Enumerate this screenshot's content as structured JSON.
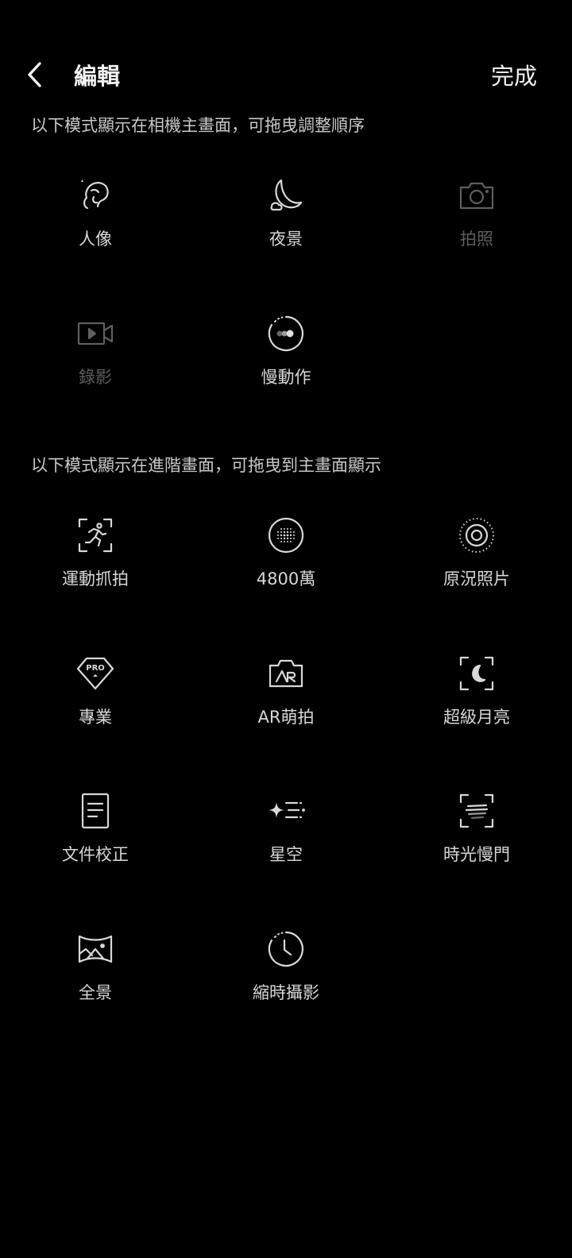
{
  "header": {
    "title": "編輯",
    "done_label": "完成"
  },
  "main_section": {
    "description": "以下模式顯示在相機主畫面，可拖曳調整順序",
    "modes": [
      {
        "label": "人像",
        "icon": "portrait-icon",
        "enabled": true
      },
      {
        "label": "夜景",
        "icon": "moon-icon",
        "enabled": true
      },
      {
        "label": "拍照",
        "icon": "camera-icon",
        "enabled": false
      },
      {
        "label": "錄影",
        "icon": "video-icon",
        "enabled": false
      },
      {
        "label": "慢動作",
        "icon": "slow-motion-icon",
        "enabled": true
      }
    ]
  },
  "advanced_section": {
    "description": "以下模式顯示在進階畫面，可拖曳到主畫面顯示",
    "modes": [
      {
        "label": "運動抓拍",
        "icon": "sports-capture-icon"
      },
      {
        "label": "4800萬",
        "icon": "high-resolution-icon"
      },
      {
        "label": "原況照片",
        "icon": "live-photo-icon"
      },
      {
        "label": "專業",
        "icon": "pro-mode-icon"
      },
      {
        "label": "AR萌拍",
        "icon": "ar-camera-icon"
      },
      {
        "label": "超級月亮",
        "icon": "super-moon-icon"
      },
      {
        "label": "文件校正",
        "icon": "document-icon"
      },
      {
        "label": "星空",
        "icon": "starry-sky-icon"
      },
      {
        "label": "時光慢門",
        "icon": "long-exposure-icon"
      },
      {
        "label": "全景",
        "icon": "panorama-icon"
      },
      {
        "label": "縮時攝影",
        "icon": "timelapse-icon"
      }
    ]
  },
  "colors": {
    "background": "#000000",
    "text_primary": "#f2f2f2",
    "text_secondary": "#d8d8d8",
    "text_disabled": "#5e5e5e"
  }
}
